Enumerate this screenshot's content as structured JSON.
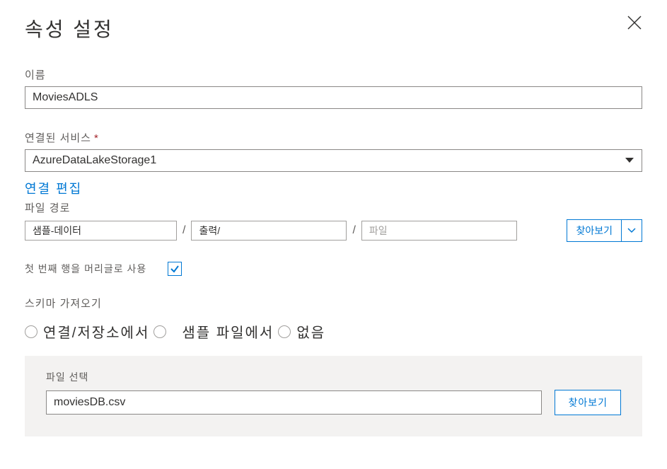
{
  "dialog": {
    "title": "속성 설정"
  },
  "name": {
    "label": "이름",
    "value": "MoviesADLS"
  },
  "linkedService": {
    "label": "연결된 서비스",
    "value": "AzureDataLakeStorage1",
    "editLink": "연결 편집"
  },
  "filePath": {
    "label": "파일 경로",
    "seg1": "샘플-데이터",
    "seg2": "출력/",
    "seg3_placeholder": "파일",
    "browse": "찾아보기"
  },
  "firstRowHeader": {
    "label": "첫 번째 행을 머리글로 사용",
    "checked": true
  },
  "schemaImport": {
    "label": "스키마 가져오기",
    "option1": "연결/저장소에서",
    "option2": "샘플 파일에서",
    "option3": "없음"
  },
  "fileSelect": {
    "label": "파일 선택",
    "value": "moviesDB.csv",
    "browse": "찾아보기"
  }
}
